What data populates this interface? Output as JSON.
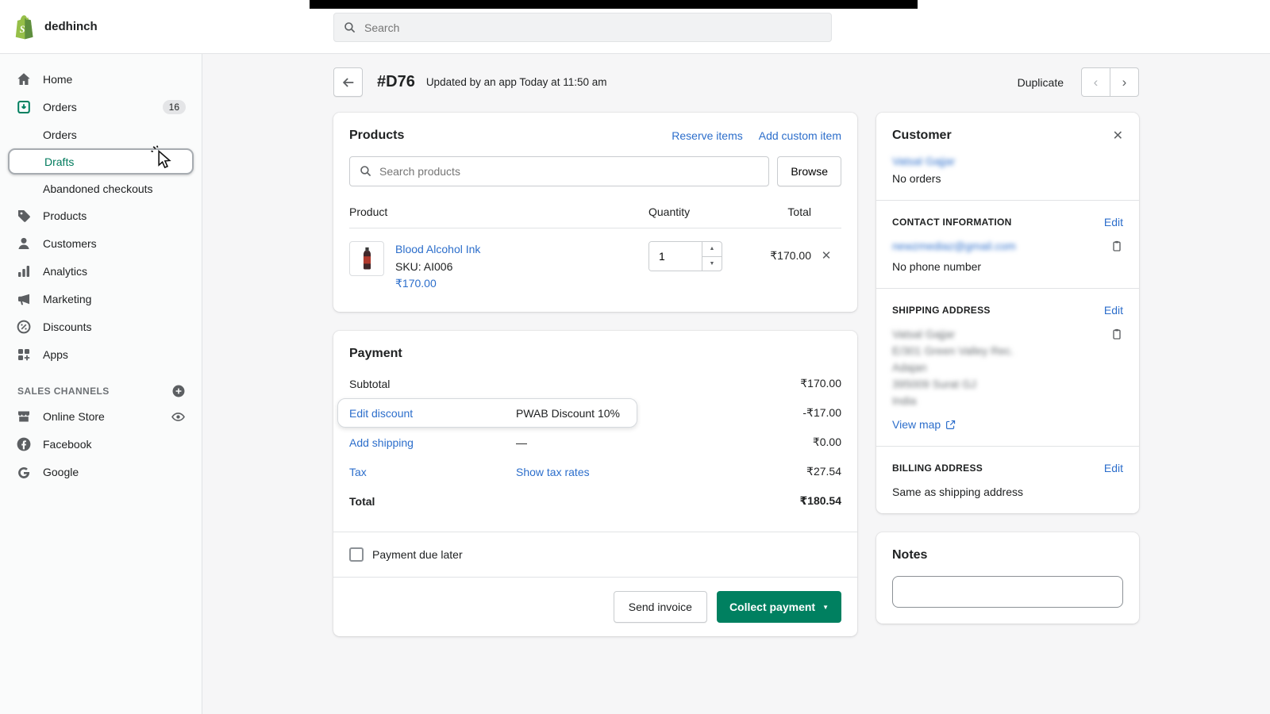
{
  "colors": {
    "accent": "#008060",
    "link": "#2c6ecb"
  },
  "topbar": {
    "store_name": "dedhinch",
    "search_placeholder": "Search"
  },
  "sidebar": {
    "items": [
      {
        "label": "Home"
      },
      {
        "label": "Orders",
        "badge": "16"
      },
      {
        "label": "Orders"
      },
      {
        "label": "Drafts"
      },
      {
        "label": "Abandoned checkouts"
      },
      {
        "label": "Products"
      },
      {
        "label": "Customers"
      },
      {
        "label": "Analytics"
      },
      {
        "label": "Marketing"
      },
      {
        "label": "Discounts"
      },
      {
        "label": "Apps"
      }
    ],
    "sales_channels_label": "SALES CHANNELS",
    "channels": [
      {
        "label": "Online Store"
      },
      {
        "label": "Facebook"
      },
      {
        "label": "Google"
      }
    ]
  },
  "header": {
    "order_id": "#D76",
    "updated": "Updated by an app Today at 11:50 am",
    "duplicate_label": "Duplicate"
  },
  "products": {
    "title": "Products",
    "reserve_items": "Reserve items",
    "add_custom_item": "Add custom item",
    "search_placeholder": "Search products",
    "browse": "Browse",
    "col_product": "Product",
    "col_quantity": "Quantity",
    "col_total": "Total",
    "item": {
      "name": "Blood Alcohol Ink",
      "sku": "SKU: AI006",
      "price": "₹170.00",
      "quantity": "1",
      "total": "₹170.00"
    }
  },
  "payment": {
    "title": "Payment",
    "subtotal_label": "Subtotal",
    "subtotal_value": "₹170.00",
    "discount_label": "Edit discount",
    "discount_name": "PWAB Discount 10%",
    "discount_value": "-₹17.00",
    "shipping_label": "Add shipping",
    "shipping_dash": "—",
    "shipping_value": "₹0.00",
    "tax_label": "Tax",
    "tax_link": "Show tax rates",
    "tax_value": "₹27.54",
    "total_label": "Total",
    "total_value": "₹180.54",
    "due_later": "Payment due later",
    "send_invoice": "Send invoice",
    "collect_payment": "Collect payment"
  },
  "customer": {
    "title": "Customer",
    "name": "Vatsal Gajjar",
    "orders": "No orders",
    "contact_heading": "CONTACT INFORMATION",
    "edit": "Edit",
    "email": "newzmediaz@gmail.com",
    "phone": "No phone number",
    "shipping_heading": "SHIPPING ADDRESS",
    "address": [
      "Vatsal Gajjar",
      "E/301 Green Valley Rec.",
      "Adajan",
      "395009 Surat GJ",
      "India"
    ],
    "view_map": "View map",
    "billing_heading": "BILLING ADDRESS",
    "billing_value": "Same as shipping address"
  },
  "notes": {
    "title": "Notes"
  }
}
